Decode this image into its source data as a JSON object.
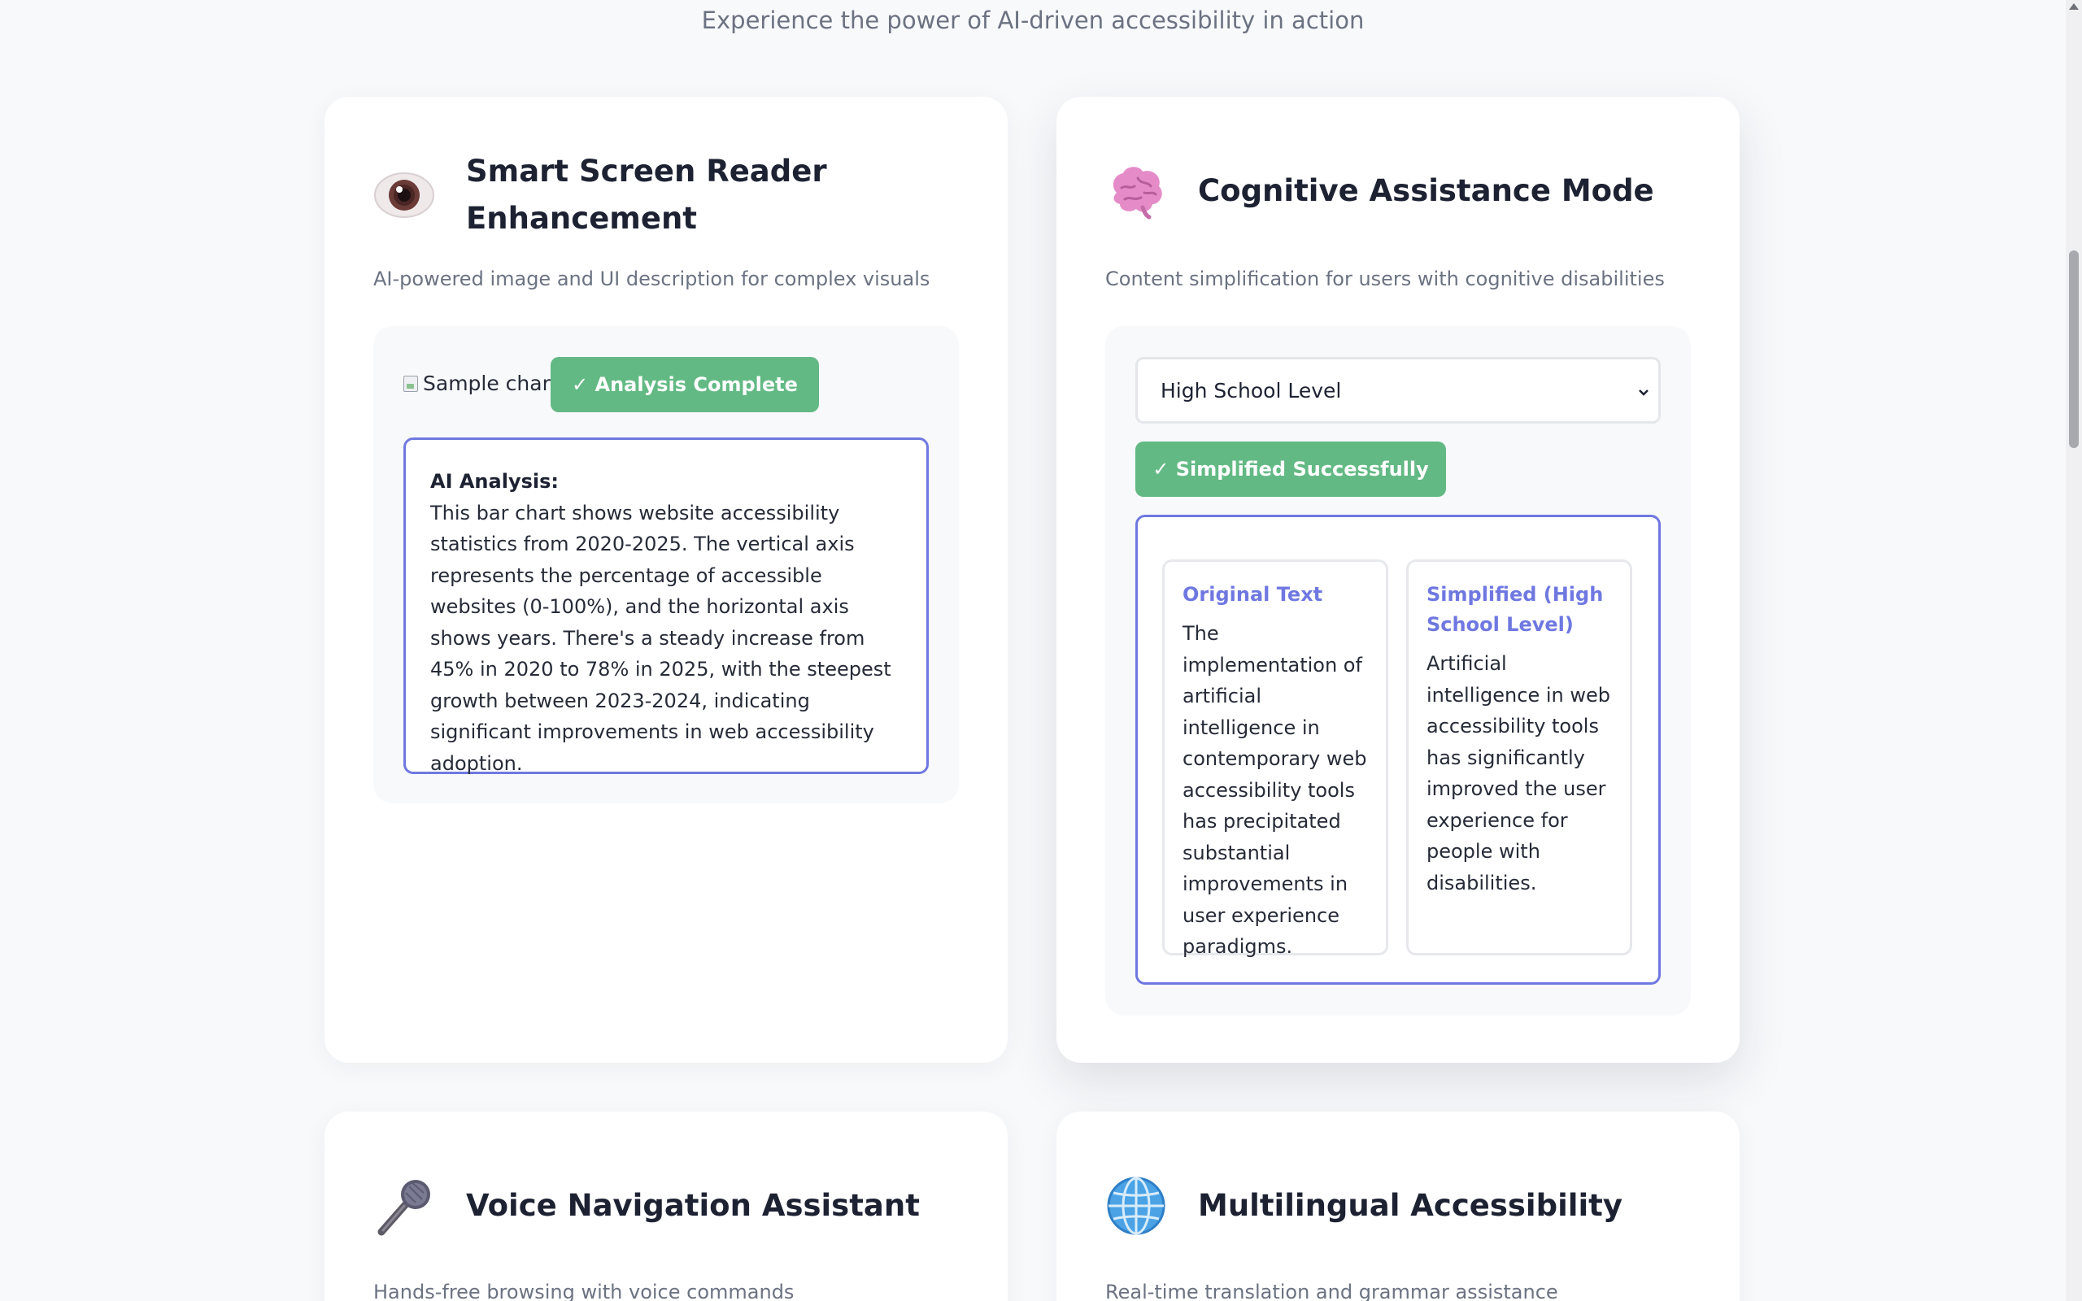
{
  "header": {
    "subtitle": "Experience the power of AI-driven accessibility in action"
  },
  "cards": {
    "screen_reader": {
      "icon": "eye-icon",
      "title_line1": "Smart Screen Reader",
      "title_line2": "Enhancement",
      "description": "AI-powered image and UI description for complex visuals",
      "image_alt": "Sample chart",
      "status_button": "✓ Analysis Complete",
      "analysis_heading": "AI Analysis:",
      "analysis_text": "This bar chart shows website accessibility statistics from 2020-2025. The vertical axis represents the percentage of accessible websites (0-100%), and the horizontal axis shows years. There's a steady increase from 45% in 2020 to 78% in 2025, with the steepest growth between 2023-2024, indicating significant improvements in web accessibility adoption."
    },
    "cognitive": {
      "icon": "brain-icon",
      "title": "Cognitive Assistance Mode",
      "description": "Content simplification for users with cognitive disabilities",
      "reading_level_selected": "High School Level",
      "status_button": "✓ Simplified Successfully",
      "original_heading": "Original Text",
      "original_text": "The implementation of artificial intelligence in contemporary web accessibility tools has precipitated substantial improvements in user experience paradigms.",
      "simplified_heading": "Simplified (High School Level)",
      "simplified_text": "Artificial intelligence in web accessibility tools has significantly improved the user experience for people with disabilities."
    },
    "voice": {
      "icon": "microphone-icon",
      "title": "Voice Navigation Assistant",
      "description": "Hands-free browsing with voice commands"
    },
    "multilingual": {
      "icon": "globe-icon",
      "title": "Multilingual Accessibility",
      "description": "Real-time translation and grammar assistance"
    }
  },
  "colors": {
    "accent": "#6f78e0",
    "success": "#63b984",
    "muted_text": "#6b7282",
    "card_bg": "#ffffff",
    "page_bg": "#f8f9fb"
  }
}
